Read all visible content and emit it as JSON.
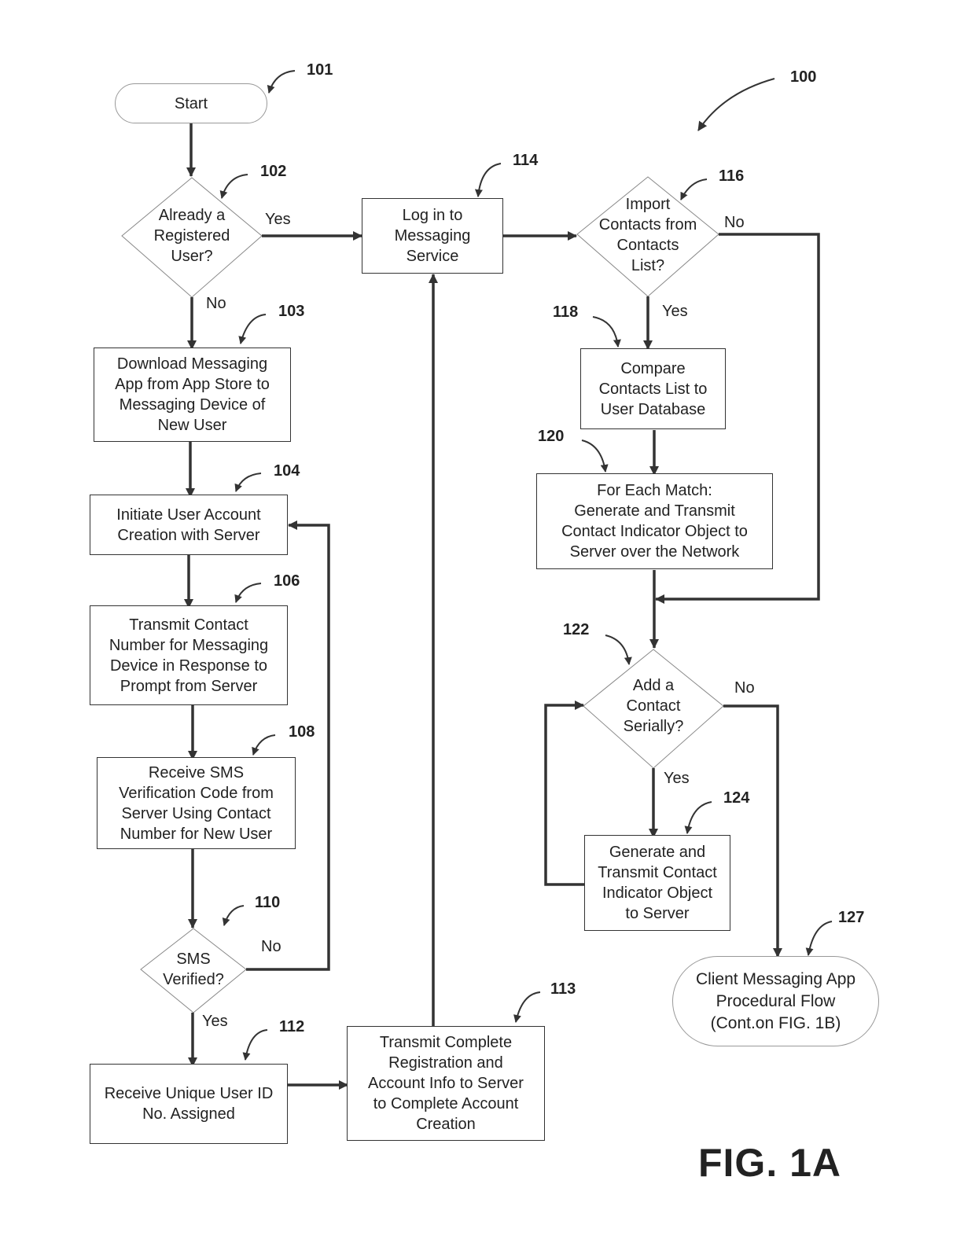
{
  "figure": {
    "diagram_ref": "100",
    "caption": "FIG. 1A"
  },
  "nodes": {
    "start": {
      "ref": "101",
      "text": "Start"
    },
    "registered": {
      "ref": "102",
      "text": "Already a\nRegistered\nUser?"
    },
    "download": {
      "ref": "103",
      "text": "Download Messaging\nApp from App Store to\nMessaging Device of\nNew User"
    },
    "initiate": {
      "ref": "104",
      "text": "Initiate User Account\nCreation with Server"
    },
    "transmit_number": {
      "ref": "106",
      "text": "Transmit Contact\nNumber for Messaging\nDevice in Response to\nPrompt from Server"
    },
    "receive_sms": {
      "ref": "108",
      "text": "Receive SMS\nVerification Code from\nServer Using Contact\nNumber for New User"
    },
    "sms_verified": {
      "ref": "110",
      "text": "SMS\nVerified?"
    },
    "receive_id": {
      "ref": "112",
      "text": "Receive Unique User ID\nNo. Assigned"
    },
    "transmit_complete": {
      "ref": "113",
      "text": "Transmit Complete\nRegistration and\nAccount Info to Server\nto Complete Account\nCreation"
    },
    "login": {
      "ref": "114",
      "text": "Log in to\nMessaging\nService"
    },
    "import": {
      "ref": "116",
      "text": "Import\nContacts from\nContacts\nList?"
    },
    "compare": {
      "ref": "118",
      "text": "Compare\nContacts List to\nUser Database"
    },
    "each_match": {
      "ref": "120",
      "text": "For Each Match:\nGenerate and Transmit\nContact Indicator Object to\nServer over the Network"
    },
    "add_serially": {
      "ref": "122",
      "text": "Add a\nContact\nSerially?"
    },
    "generate": {
      "ref": "124",
      "text": "Generate and\nTransmit Contact\nIndicator Object\nto Server"
    },
    "client_flow": {
      "ref": "127",
      "text": "Client Messaging App\nProcedural Flow\n(Cont.on FIG. 1B)"
    }
  },
  "edge_labels": {
    "registered_yes": "Yes",
    "registered_no": "No",
    "sms_no": "No",
    "sms_yes": "Yes",
    "import_no": "No",
    "import_yes": "Yes",
    "add_no": "No",
    "add_yes": "Yes"
  }
}
